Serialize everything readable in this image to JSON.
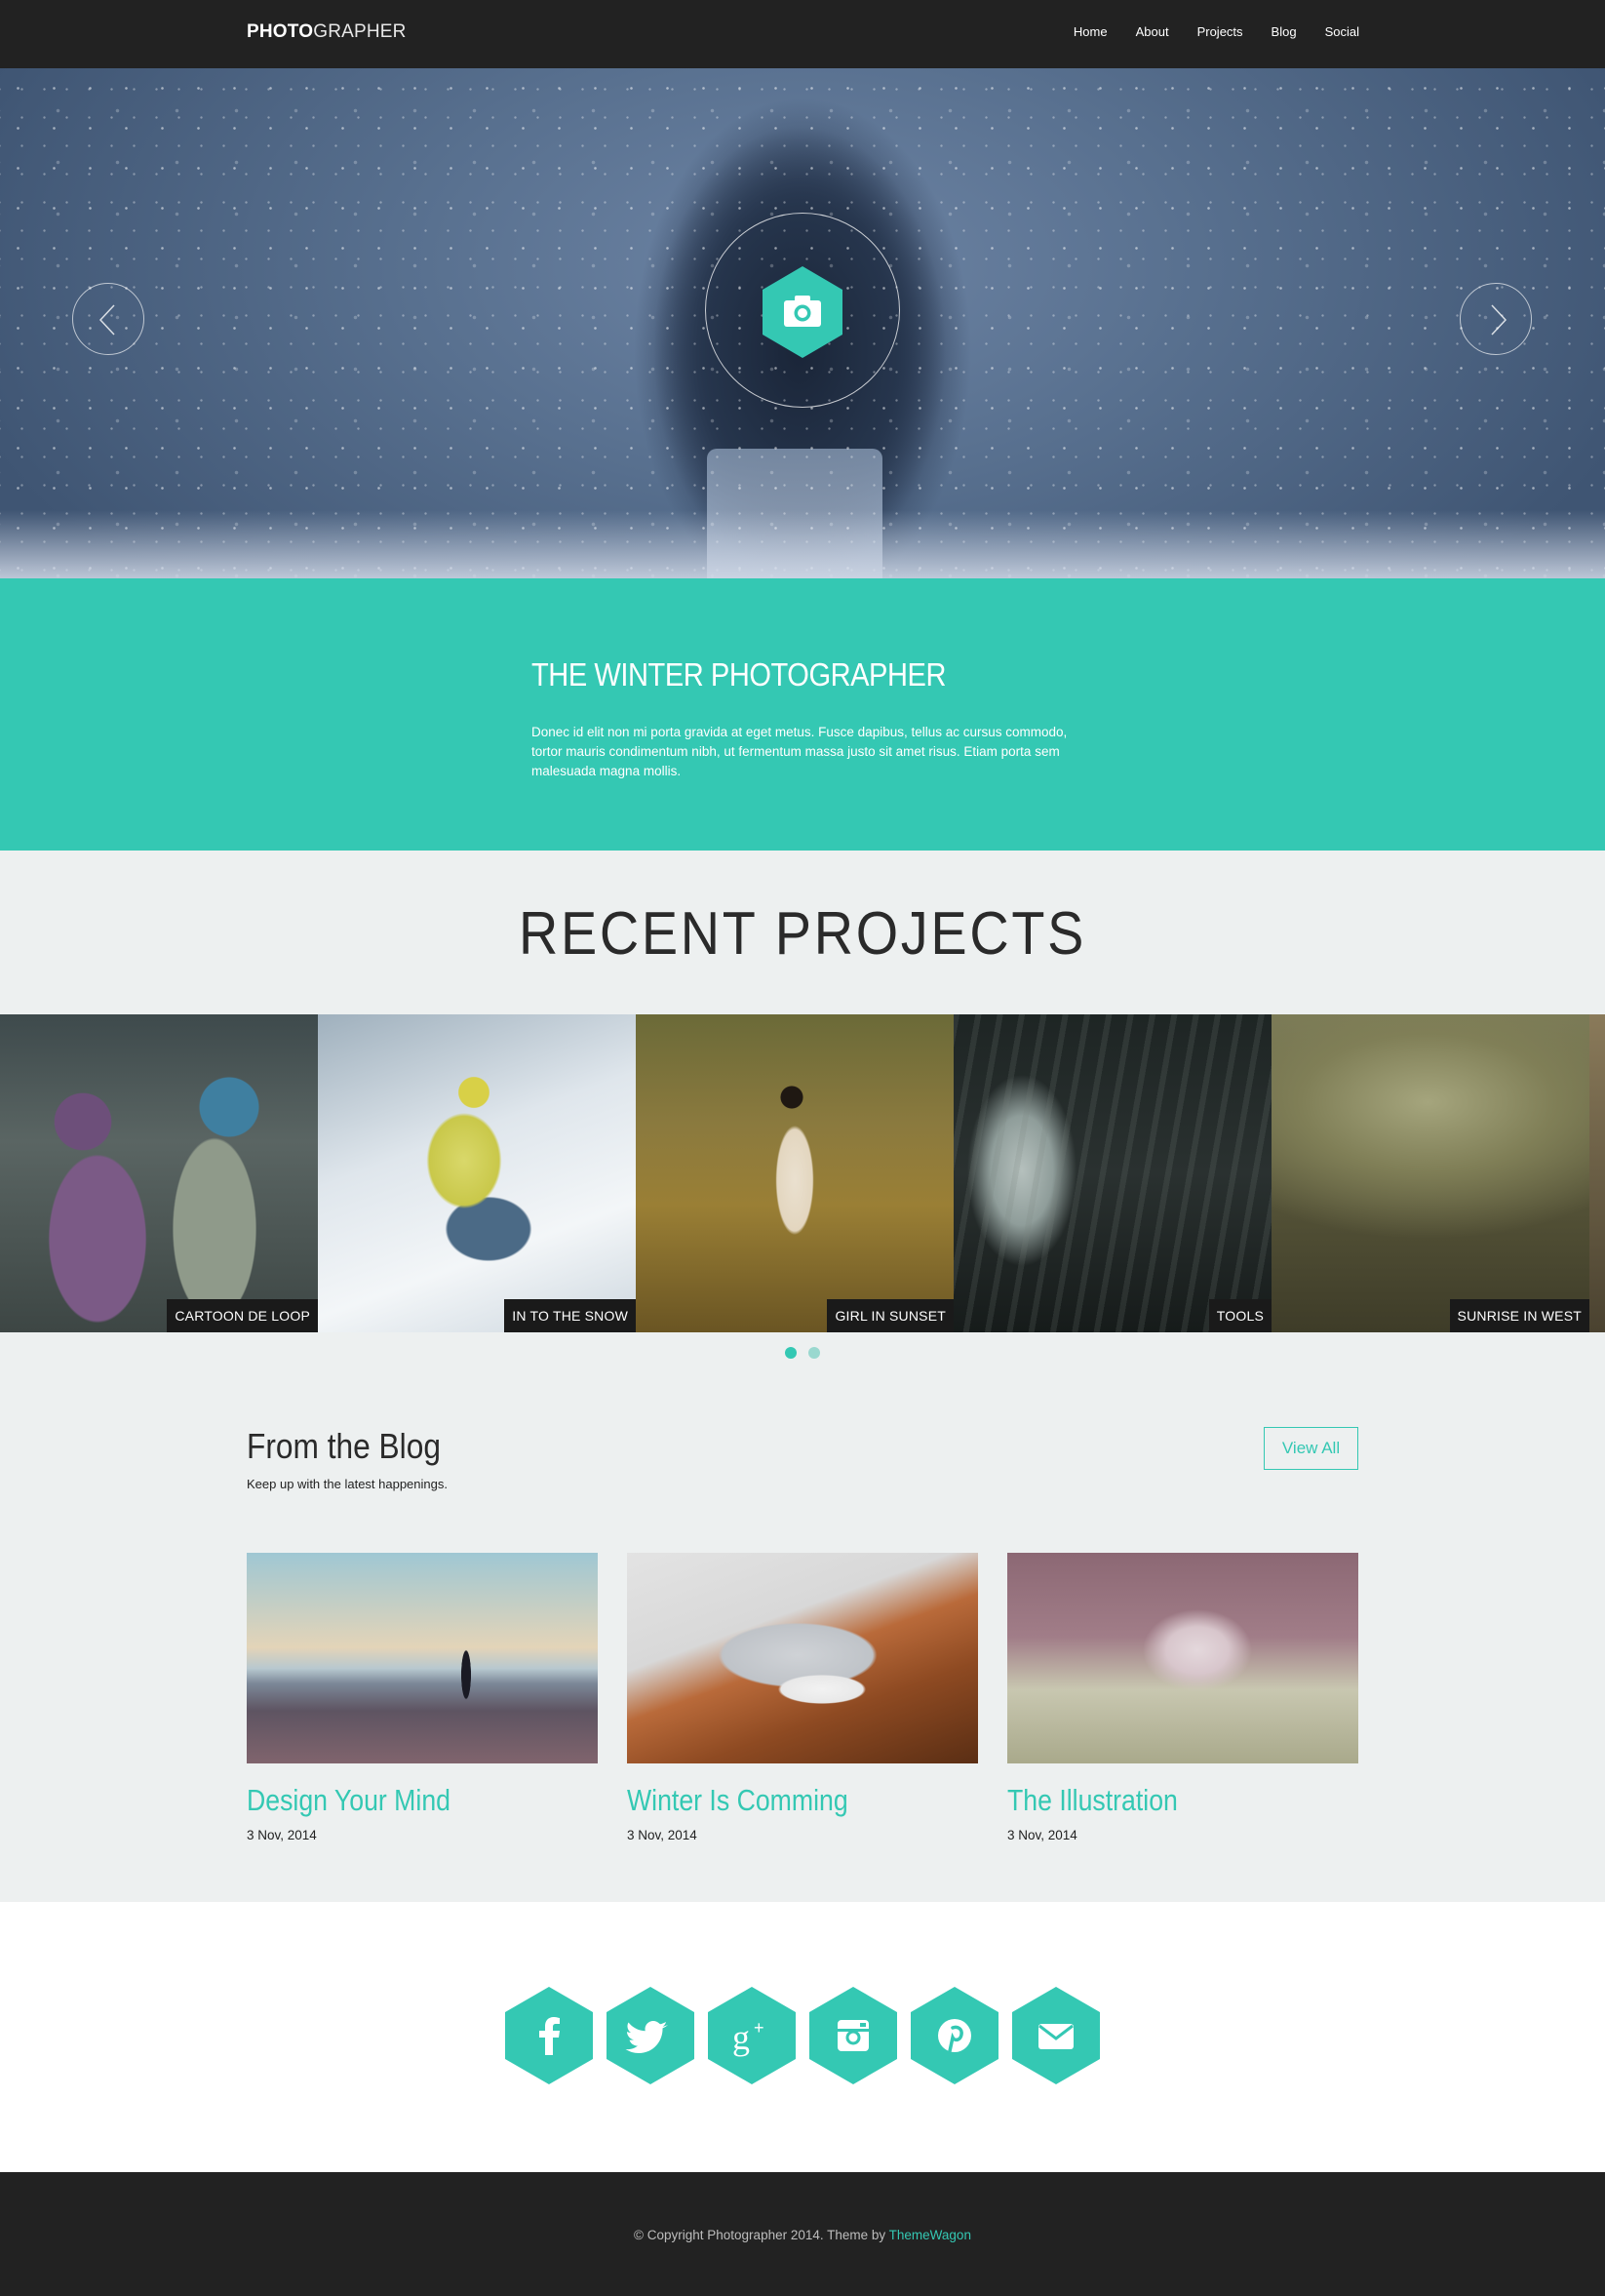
{
  "colors": {
    "accent": "#34c8b3",
    "dark": "#222222",
    "light_bg": "#edf0f0"
  },
  "nav": {
    "logo_bold": "PHOTO",
    "logo_light": "GRAPHER",
    "items": [
      "Home",
      "About",
      "Projects",
      "Blog",
      "Social"
    ]
  },
  "hero": {
    "icon": "camera-icon",
    "prev_icon": "chevron-left-icon",
    "next_icon": "chevron-right-icon"
  },
  "intro": {
    "title": "THE WINTER PHOTOGRAPHER",
    "text": "Donec id elit non mi porta gravida at eget metus. Fusce dapibus, tellus ac cursus commodo, tortor mauris condimentum nibh, ut fermentum massa justo sit amet risus. Etiam porta sem malesuada magna mollis."
  },
  "projects": {
    "title": "RECENT PROJECTS",
    "items": [
      "CARTOON DE LOOP",
      "IN TO THE SNOW",
      "GIRL IN SUNSET",
      "TOOLS",
      "SUNRISE IN WEST"
    ]
  },
  "blog": {
    "title": "From the Blog",
    "subtitle": "Keep up with the latest happenings.",
    "view_all": "View All",
    "posts": [
      {
        "title": "Design Your Mind",
        "date": "3 Nov, 2014"
      },
      {
        "title": "Winter Is Comming",
        "date": "3 Nov, 2014"
      },
      {
        "title": "The Illustration",
        "date": "3 Nov, 2014"
      }
    ]
  },
  "social": {
    "icons": [
      "facebook-icon",
      "twitter-icon",
      "google-plus-icon",
      "instagram-icon",
      "pinterest-icon",
      "email-icon"
    ]
  },
  "footer": {
    "text": "© Copyright Photographer 2014. Theme by ",
    "link": "ThemeWagon"
  }
}
